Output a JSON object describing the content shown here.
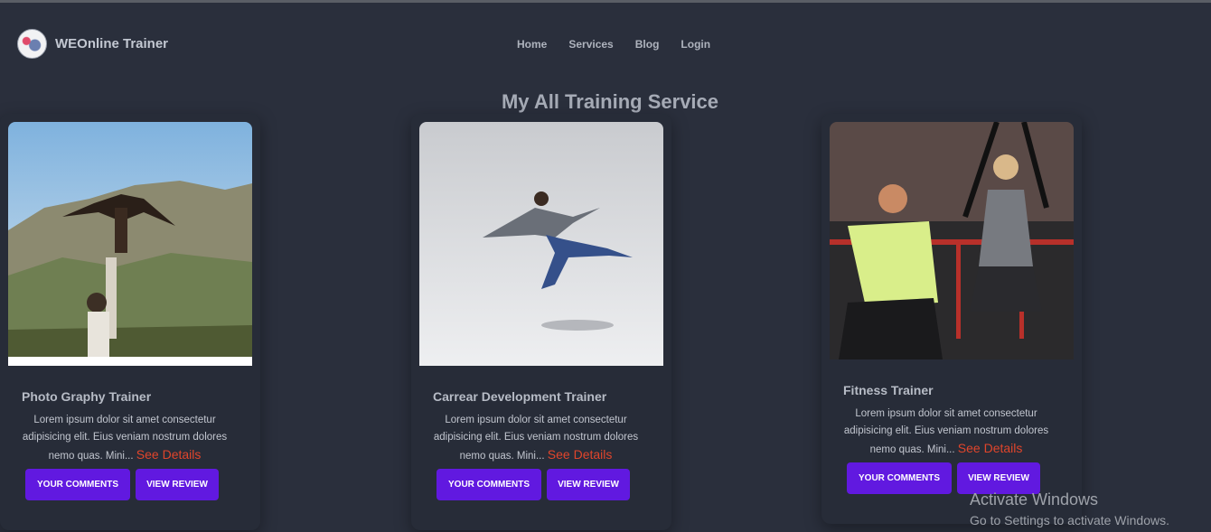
{
  "brand": {
    "name": "WEOnline Trainer"
  },
  "nav": [
    "Home",
    "Services",
    "Blog",
    "Login"
  ],
  "page_title": "My All Training Service",
  "cards": [
    {
      "title": "Photo Graphy Trainer",
      "text": "Lorem ipsum dolor sit amet consectetur adipisicing elit. Eius veniam nostrum dolores nemo quas. Mini...",
      "link": "See Details",
      "btn_comments": "YOUR COMMENTS",
      "btn_review": "VIEW REVIEW"
    },
    {
      "title": "Carrear Development Trainer",
      "text": "Lorem ipsum dolor sit amet consectetur adipisicing elit. Eius veniam nostrum dolores nemo quas. Mini...",
      "link": "See Details",
      "btn_comments": "YOUR COMMENTS",
      "btn_review": "VIEW REVIEW"
    },
    {
      "title": "Fitness Trainer",
      "text": "Lorem ipsum dolor sit amet consectetur adipisicing elit. Eius veniam nostrum dolores nemo quas. Mini...",
      "link": "See Details",
      "btn_comments": "YOUR COMMENTS",
      "btn_review": "VIEW REVIEW"
    }
  ],
  "watermark": {
    "line1": "Activate Windows",
    "line2": "Go to Settings to activate Windows."
  },
  "colors": {
    "background": "#2a2f3c",
    "button": "#6119e0",
    "link": "#e0452b"
  }
}
